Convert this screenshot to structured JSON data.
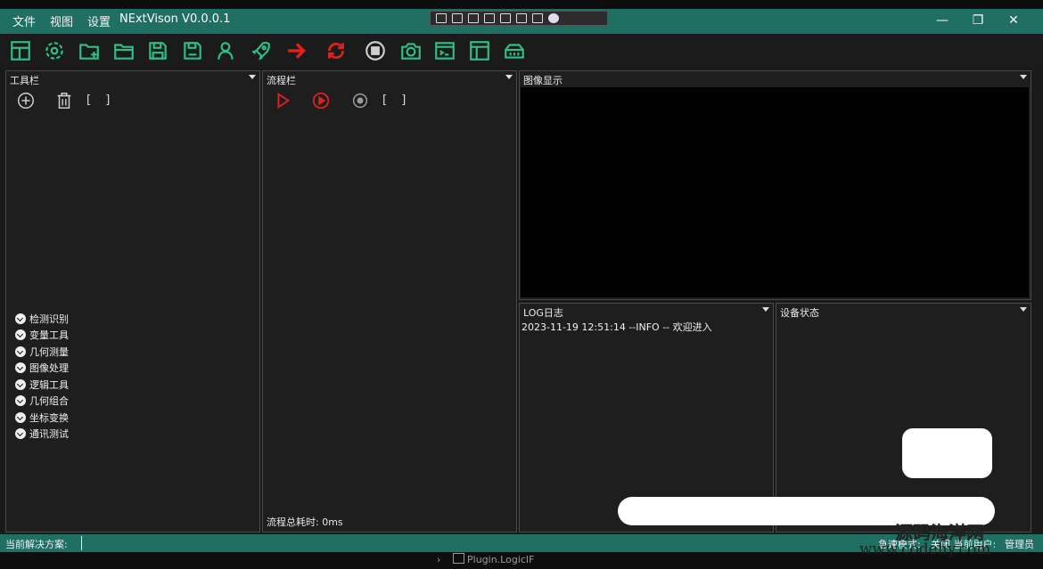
{
  "titlebar": {
    "menu": [
      "文件",
      "视图",
      "设置"
    ],
    "app_title": "NExtVison V0.0.0.1",
    "window_controls": {
      "minimize": "—",
      "maximize": "❐",
      "close": "✕"
    }
  },
  "toolbar": {
    "icons": [
      "layout-icon",
      "settings-icon",
      "add-folder-icon",
      "folder-icon",
      "save-icon",
      "save-as-icon",
      "user-icon",
      "rocket-icon",
      "arrow-right-icon",
      "refresh-icon",
      "stop-icon",
      "camera-icon",
      "console-icon",
      "window-icon",
      "device-icon"
    ]
  },
  "colors": {
    "accent": "#1f6f63",
    "icon_green": "#2fbf86",
    "icon_red": "#e02020"
  },
  "tool_panel": {
    "title": "工具栏",
    "bracket": "[ ]",
    "categories": [
      "检测识别",
      "变量工具",
      "几何测量",
      "图像处理",
      "逻辑工具",
      "几何组合",
      "坐标变换",
      "通讯测试"
    ]
  },
  "flow_panel": {
    "title": "流程栏",
    "bracket": "[ ]",
    "total_time": "流程总耗时:  0ms"
  },
  "image_panel": {
    "title": "图像显示"
  },
  "log_panel": {
    "title": "LOG日志",
    "entries": [
      "2023-11-19 12:51:14 --INFO -- 欢迎进入"
    ]
  },
  "device_panel": {
    "title": "设备状态"
  },
  "statusbar": {
    "solution_label": "当前解决方案:",
    "mode": "急速模式:",
    "right_text": "关闭  当前用户:",
    "user": "管理员"
  },
  "bottom": {
    "plugin": "Plugin.LogicIF"
  },
  "watermark": {
    "cn": "源码海洋网",
    "url": "www.codehy.com"
  }
}
